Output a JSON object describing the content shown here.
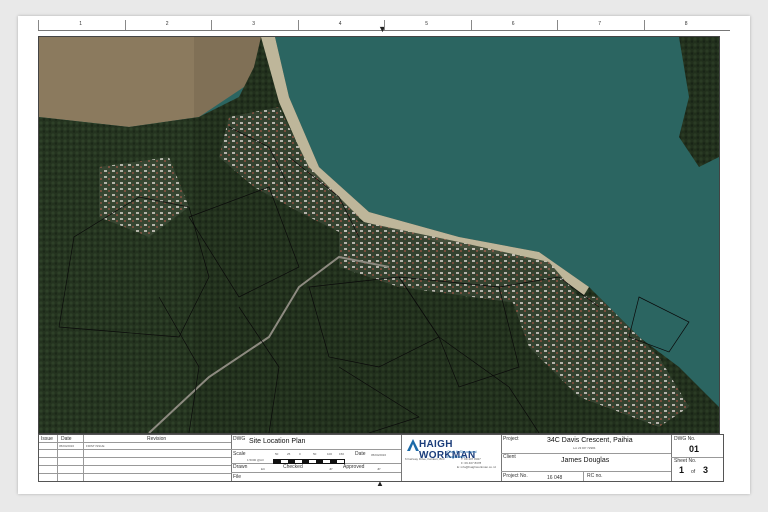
{
  "ruler": {
    "columns": [
      "1",
      "2",
      "3",
      "4",
      "5",
      "6",
      "7",
      "8"
    ]
  },
  "titleblock": {
    "revision_table": {
      "headers": [
        "Issue",
        "Date",
        "Revision"
      ],
      "rows": [
        {
          "issue": "",
          "date": "05/04/2016",
          "revision": "FIRST ISSUE"
        }
      ]
    },
    "dwg_label": "DWG",
    "dwg_title": "Site Location Plan",
    "scale_label": "Scale",
    "scale_value": "1:5000 @A3",
    "date_label": "Date",
    "date_value": "05/04/2016",
    "drawn_label": "Drawn",
    "drawn_value": "EC",
    "checked_label": "Checked",
    "checked_value": "JP",
    "approved_label": "Approved",
    "approved_value": "JP",
    "file_label": "File",
    "scalebar_labels": [
      "50",
      "25",
      "0",
      "50",
      "100",
      "150"
    ],
    "firm_name": "HAIGH WORKMAN",
    "firm_tagline": "Civil & Structural Engineers",
    "firm_address": "6 Fairway Drive, Kerikeri, BOI",
    "firm_phone": "T: 09 407 8327",
    "firm_fax": "F: 09 407 8378",
    "firm_email": "E: info@haighworkman.co.nz",
    "project_label": "Project",
    "project_value": "34C Davis Crescent, Paihia",
    "project_lot": "Lot 23 DP 72984",
    "client_label": "Client",
    "client_value": "James Douglas",
    "project_no_label": "Project No.",
    "project_no_value": "16 048",
    "rc_label": "RC no.",
    "dwg_no_label": "DWG No.",
    "dwg_no_value": "01",
    "sheet_no_label": "Sheet No.",
    "sheet_value": "1",
    "sheet_of": "of",
    "sheet_total": "3"
  },
  "colors": {
    "sea": "#2f6e6a",
    "forest": "#24331f",
    "mudflat": "#8b7a5e",
    "sand": "#cfc6a8",
    "logo": "#1c3d7a"
  }
}
